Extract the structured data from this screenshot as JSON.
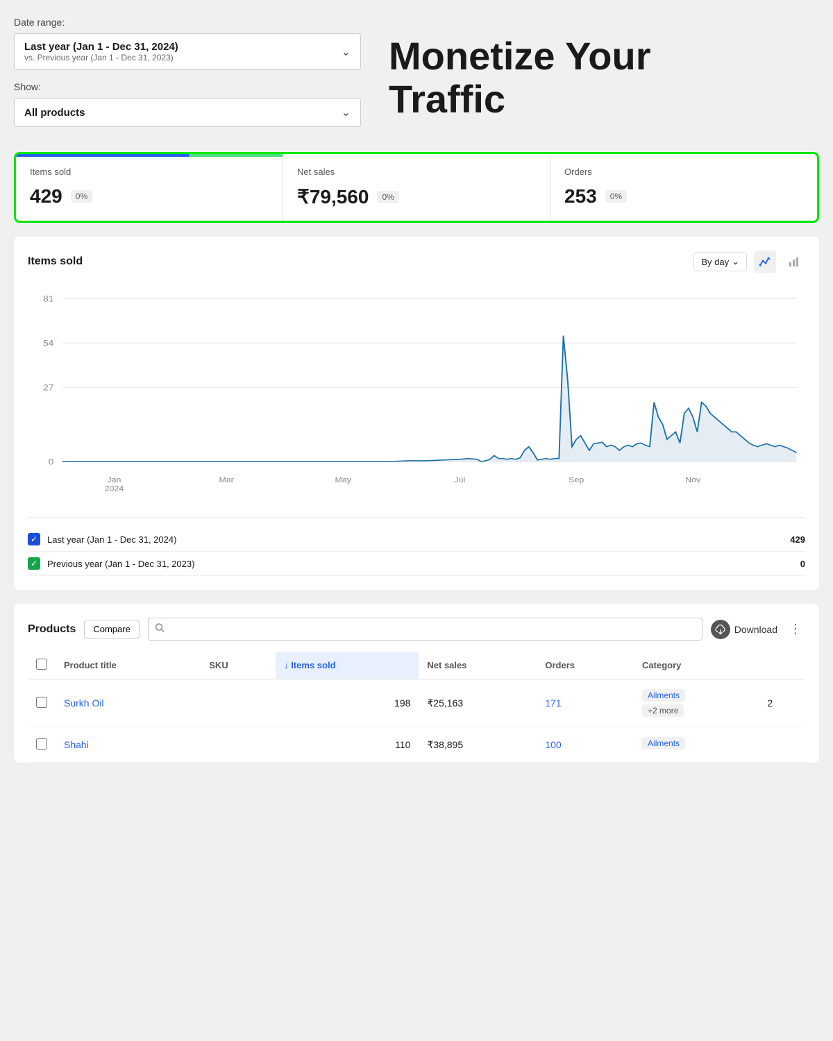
{
  "date_range": {
    "label": "Date range:",
    "value_main": "Last year (Jan 1 - Dec 31, 2024)",
    "value_sub": "vs. Previous year (Jan 1 - Dec 31, 2023)"
  },
  "show": {
    "label": "Show:",
    "value": "All products"
  },
  "promo": {
    "line1": "Monetize Your",
    "line2": "Traffic"
  },
  "stats": [
    {
      "label": "Items sold",
      "value": "429",
      "badge": "0%"
    },
    {
      "label": "Net sales",
      "value": "₹79,560",
      "badge": "0%"
    },
    {
      "label": "Orders",
      "value": "253",
      "badge": "0%"
    }
  ],
  "chart": {
    "title": "Items sold",
    "by_day": "By day",
    "y_labels": [
      "81",
      "54",
      "27",
      "0"
    ],
    "x_labels": [
      "Jan\n2024",
      "Mar",
      "May",
      "Jul",
      "Sep",
      "Nov"
    ]
  },
  "legend": [
    {
      "label": "Last year (Jan 1 - Dec 31, 2024)",
      "value": "429",
      "color": "#1d4ed8"
    },
    {
      "label": "Previous year (Jan 1 - Dec 31, 2023)",
      "value": "0",
      "color": "#16a34a"
    }
  ],
  "products": {
    "title": "Products",
    "compare_btn": "Compare",
    "search_placeholder": "",
    "download_label": "Download",
    "columns": [
      "Product title",
      "SKU",
      "↓ Items sold",
      "Net sales",
      "Orders",
      "Category"
    ],
    "rows": [
      {
        "name": "Surkh Oil",
        "sku": "",
        "items_sold": "198",
        "net_sales": "₹25,163",
        "orders": "171",
        "category_main": "Ailments",
        "category_extra": "+2 more",
        "extra_col": "2"
      },
      {
        "name": "Shahi",
        "sku": "",
        "items_sold": "110",
        "net_sales": "₹38,895",
        "orders": "100",
        "category_main": "Ailments",
        "category_extra": "",
        "extra_col": ""
      }
    ]
  }
}
